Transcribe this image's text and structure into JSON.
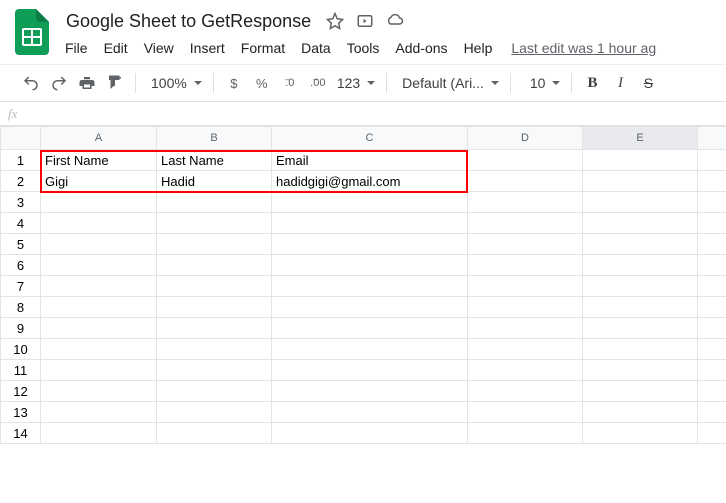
{
  "header": {
    "doc_title": "Google Sheet to GetResponse",
    "menus": [
      "File",
      "Edit",
      "View",
      "Insert",
      "Format",
      "Data",
      "Tools",
      "Add-ons",
      "Help"
    ],
    "last_edit": "Last edit was 1 hour ag"
  },
  "toolbar": {
    "zoom": "100%",
    "currency": "$",
    "percent": "%",
    "dec_decrease": ".0",
    "dec_increase": ".00",
    "numfmt": "123",
    "font": "Default (Ari...",
    "font_size": "10",
    "bold": "B",
    "italic": "I",
    "strike": "S"
  },
  "formula_bar": {
    "fx": "fx"
  },
  "grid": {
    "columns": [
      "A",
      "B",
      "C",
      "D",
      "E",
      ""
    ],
    "selected_col_index": 4,
    "rows": [
      1,
      2,
      3,
      4,
      5,
      6,
      7,
      8,
      9,
      10,
      11,
      12,
      13,
      14
    ],
    "cells": {
      "A1": "First Name",
      "B1": "Last Name",
      "C1": "Email",
      "A2": "Gigi",
      "B2": "Hadid",
      "C2": "hadidgigi@gmail.com"
    }
  }
}
